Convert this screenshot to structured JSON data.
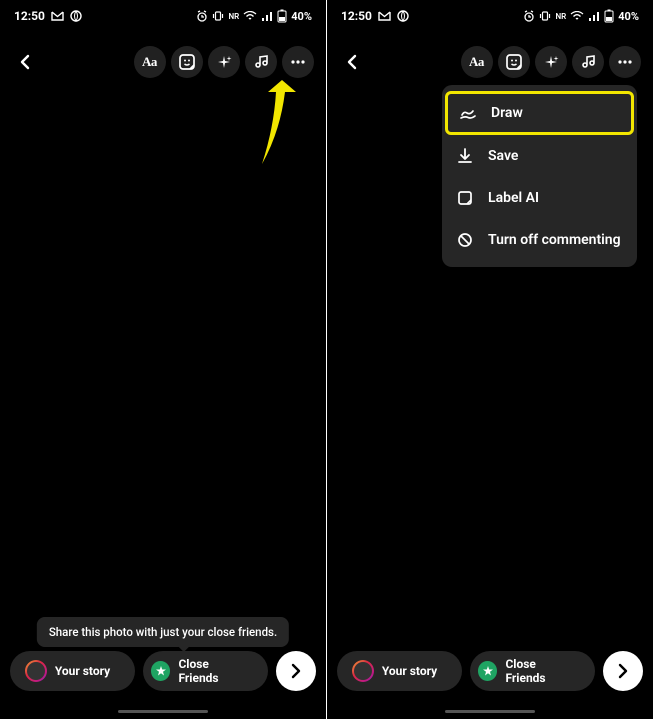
{
  "status": {
    "time": "12:50",
    "battery": "40%",
    "network_label": "NR"
  },
  "toolbar": {
    "text_label": "Aa"
  },
  "menu": {
    "draw": "Draw",
    "save": "Save",
    "label_ai": "Label AI",
    "turn_off_commenting": "Turn off commenting"
  },
  "tooltip": {
    "close_friends_hint": "Share this photo with just your close friends."
  },
  "bottom": {
    "your_story": "Your story",
    "close_friends": "Close Friends"
  },
  "annotation": {
    "arrow_color": "#f2e600"
  }
}
